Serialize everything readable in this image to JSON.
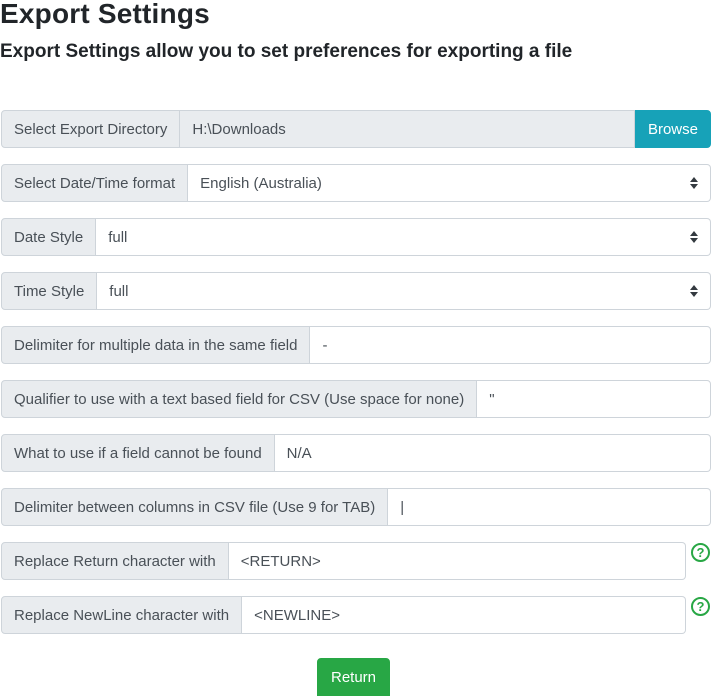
{
  "page": {
    "title": "Export Settings",
    "subtitle": "Export Settings allow you to set preferences for exporting a file"
  },
  "export_directory": {
    "label": "Select Export Directory",
    "value": "H:\\Downloads",
    "browse_label": "Browse"
  },
  "datetime_format": {
    "label": "Select Date/Time format",
    "selected": "English (Australia)"
  },
  "date_style": {
    "label": "Date Style",
    "selected": "full"
  },
  "time_style": {
    "label": "Time Style",
    "selected": "full"
  },
  "multi_delimiter": {
    "label": "Delimiter for multiple data in the same field",
    "value": "-"
  },
  "csv_qualifier": {
    "label": "Qualifier to use with a text based field for CSV (Use space for none)",
    "value": "\""
  },
  "missing_field": {
    "label": "What to use if a field cannot be found",
    "value": "N/A"
  },
  "csv_column_delimiter": {
    "label": "Delimiter between columns in CSV file (Use 9 for TAB)",
    "value": "|"
  },
  "replace_return": {
    "label": "Replace Return character with",
    "value": "<RETURN>",
    "help_icon": "question-circle-icon"
  },
  "replace_newline": {
    "label": "Replace NewLine character with",
    "value": "<NEWLINE>",
    "help_icon": "question-circle-icon"
  },
  "actions": {
    "return_label": "Return"
  },
  "colors": {
    "browse": "#17a2b8",
    "return": "#28a745",
    "help": "#28a745"
  }
}
